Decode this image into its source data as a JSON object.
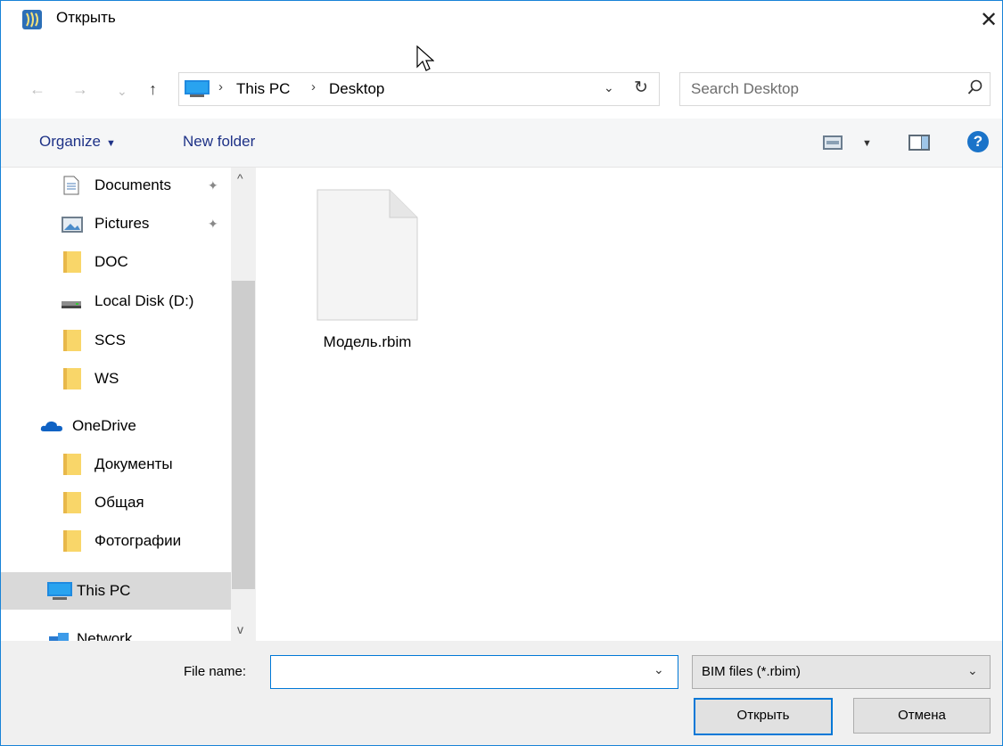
{
  "window": {
    "title": "Открыть",
    "close_glyph": "✕"
  },
  "nav": {
    "back_glyph": "←",
    "forward_glyph": "→",
    "recent_glyph": "⌄",
    "up_glyph": "↑"
  },
  "address": {
    "crumbs": [
      "This PC",
      "Desktop"
    ],
    "separator": "›",
    "dropdown_glyph": "⌄",
    "refresh_glyph": "↻"
  },
  "search": {
    "placeholder": "Search Desktop"
  },
  "toolbar": {
    "organize_label": "Organize",
    "organize_caret": "▼",
    "new_folder_label": "New folder",
    "view_caret": "▼",
    "help_glyph": "?"
  },
  "sidebar": {
    "items": [
      {
        "label": "Documents",
        "icon": "documents-icon",
        "pinned": true
      },
      {
        "label": "Pictures",
        "icon": "pictures-icon",
        "pinned": true
      },
      {
        "label": "DOC",
        "icon": "folder-icon"
      },
      {
        "label": "Local Disk (D:)",
        "icon": "drive-icon"
      },
      {
        "label": "SCS",
        "icon": "folder-icon"
      },
      {
        "label": "WS",
        "icon": "folder-icon"
      },
      {
        "label": "OneDrive",
        "icon": "onedrive-icon"
      },
      {
        "label": "Документы",
        "icon": "folder-icon"
      },
      {
        "label": "Общая",
        "icon": "folder-icon"
      },
      {
        "label": "Фотографии",
        "icon": "folder-icon"
      },
      {
        "label": "This PC",
        "icon": "computer-icon",
        "selected": true
      },
      {
        "label": "Network",
        "icon": "network-icon"
      }
    ],
    "pin_glyph": "📌",
    "scroll_up_glyph": "^",
    "scroll_down_glyph": "v"
  },
  "files": [
    {
      "name": "Модель.rbim",
      "icon": "file-icon"
    }
  ],
  "bottom": {
    "file_name_label": "File name:",
    "file_name_value": "",
    "file_name_dropdown_glyph": "⌄",
    "filter_value": "BIM files (*.rbim)",
    "filter_dropdown_glyph": "⌄",
    "open_label": "Открыть",
    "cancel_label": "Отмена"
  },
  "colors": {
    "accent": "#0078d7",
    "border": "#1883d7",
    "toolbar_text": "#1e3287",
    "folder": "#f9d669",
    "selected_bg": "#d9d9d9"
  }
}
